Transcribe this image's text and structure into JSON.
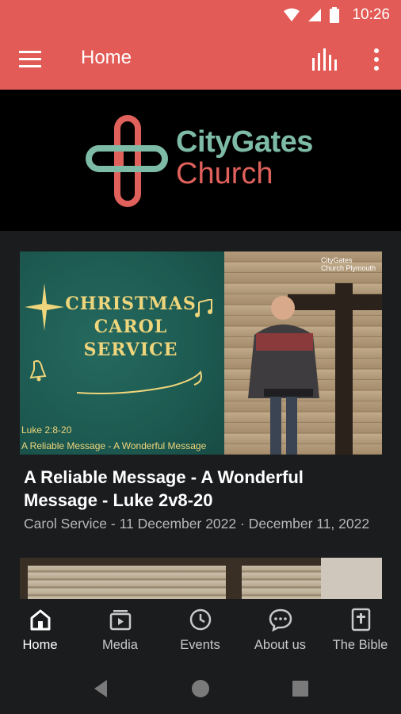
{
  "status_bar": {
    "time": "10:26"
  },
  "app_bar": {
    "title": "Home"
  },
  "banner": {
    "brand_line1": "CityGates",
    "brand_line2": "Church"
  },
  "featured": {
    "promo_title": "CHRISTMAS CAROL SERVICE",
    "promo_reference": "Luke 2:8-20",
    "promo_subtitle": "A Reliable Message - A Wonderful Message",
    "photo_logo_line1": "CityGates",
    "photo_logo_line2": "Church Plymouth",
    "title": "A Reliable Message - A Wonderful Message - Luke 2v8-20",
    "meta": "Carol Service - 11 December 2022 · December 11, 2022"
  },
  "bottom_nav": [
    {
      "label": "Home",
      "icon": "home-icon",
      "active": true
    },
    {
      "label": "Media",
      "icon": "media-icon",
      "active": false
    },
    {
      "label": "Events",
      "icon": "clock-icon",
      "active": false
    },
    {
      "label": "About us",
      "icon": "chat-bubble-icon",
      "active": false
    },
    {
      "label": "The Bible",
      "icon": "bible-icon",
      "active": false
    }
  ],
  "colors": {
    "accent": "#e35b56",
    "brand_green": "#7dbba6",
    "brand_red": "#e0615b",
    "background": "#1b1c1e"
  }
}
